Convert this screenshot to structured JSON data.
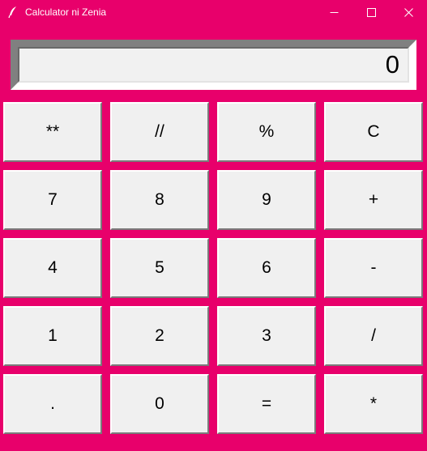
{
  "window": {
    "title": "Calculator ni Zenia",
    "background": "#e8006b",
    "icon": "feather-icon"
  },
  "display": {
    "value": "0"
  },
  "keys": [
    [
      "**",
      "//",
      "%",
      "C"
    ],
    [
      "7",
      "8",
      "9",
      "+"
    ],
    [
      "4",
      "5",
      "6",
      "-"
    ],
    [
      "1",
      "2",
      "3",
      "/"
    ],
    [
      ".",
      "0",
      "=",
      "*"
    ]
  ]
}
